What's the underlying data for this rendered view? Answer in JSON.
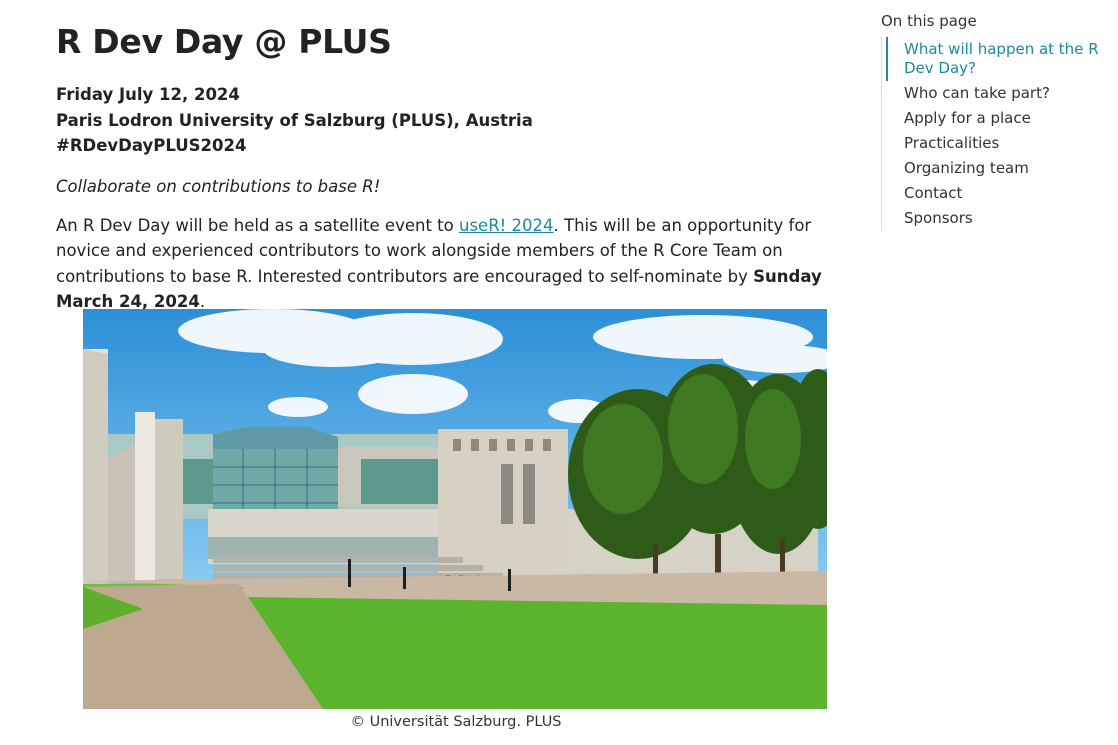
{
  "header": {
    "title": "R Dev Day @ PLUS"
  },
  "event": {
    "date": "Friday July 12, 2024",
    "venue": "Paris Lodron University of Salzburg (PLUS), Austria",
    "hashtag": "#RDevDayPLUS2024"
  },
  "tagline": "Collaborate on contributions to base R!",
  "intro": {
    "text_before_link": "An R Dev Day will be held as a satellite event to ",
    "link_text": "useR! 2024",
    "text_after_link": ". This will be an opportunity for novice and experienced contributors to work alongside members of the R Core Team on contributions to base R. Interested contributors are encouraged to self-nominate by ",
    "deadline": "Sunday March 24, 2024",
    "text_end": "."
  },
  "image": {
    "caption": "© Universität Salzburg. PLUS"
  },
  "toc": {
    "title": "On this page",
    "items": [
      {
        "label": "What will happen at the R Dev Day?",
        "active": true
      },
      {
        "label": "Who can take part?",
        "active": false
      },
      {
        "label": "Apply for a place",
        "active": false
      },
      {
        "label": "Practicalities",
        "active": false
      },
      {
        "label": "Organizing team",
        "active": false
      },
      {
        "label": "Contact",
        "active": false
      },
      {
        "label": "Sponsors",
        "active": false
      }
    ]
  },
  "colors": {
    "link": "#1a8aa3",
    "text": "#222222"
  }
}
